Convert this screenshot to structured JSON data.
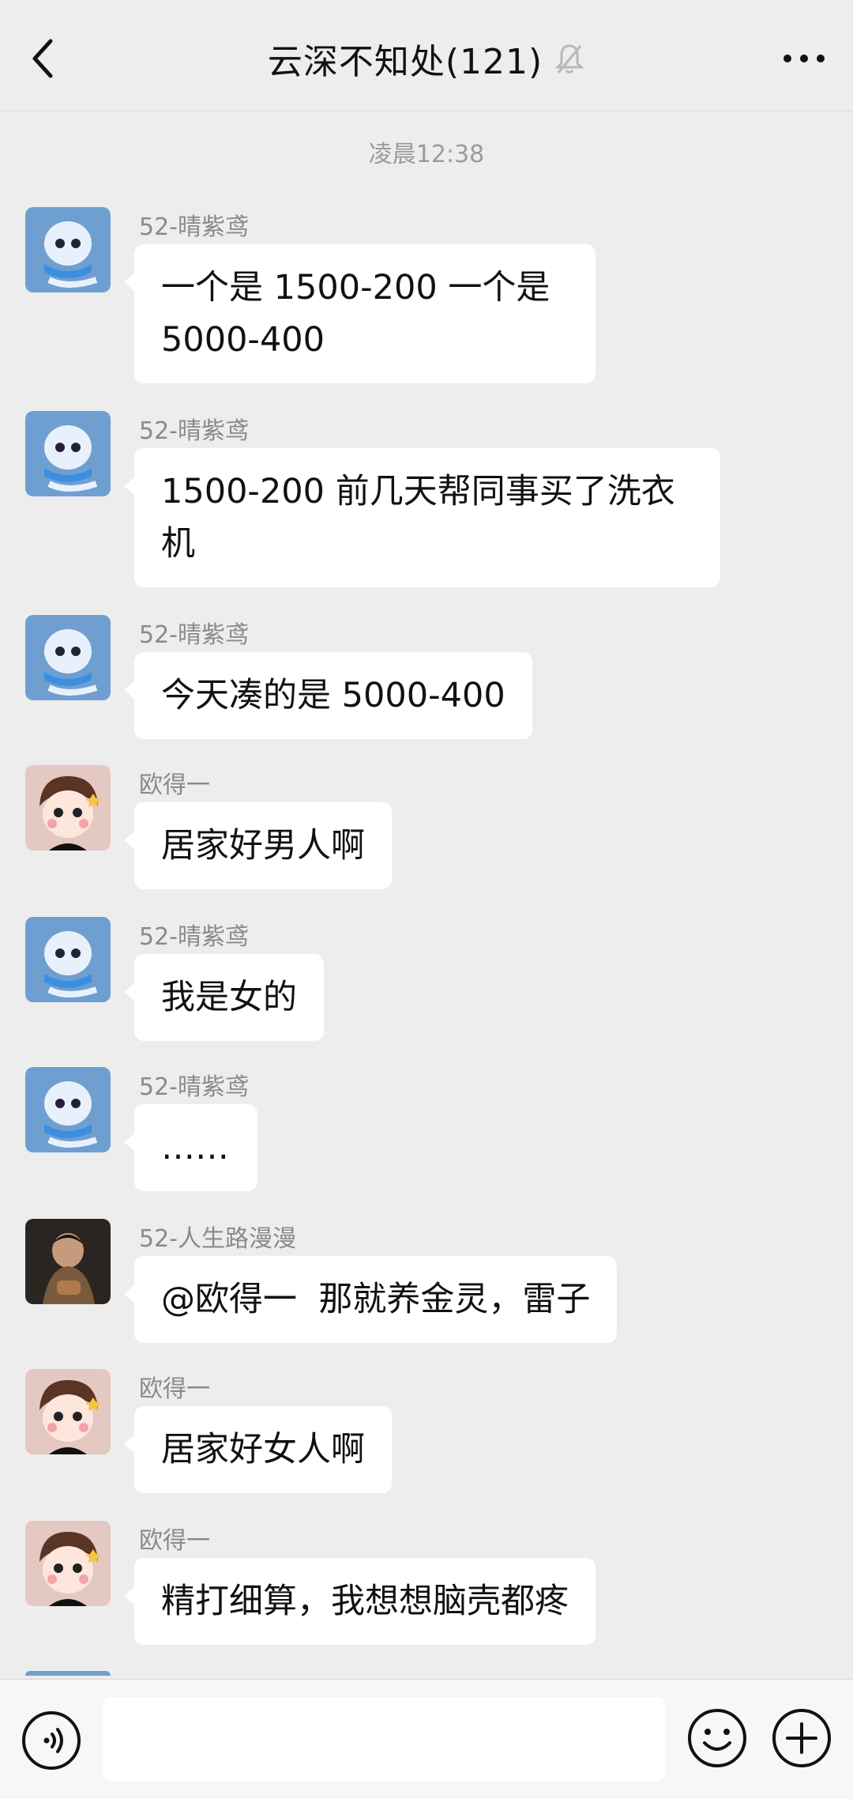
{
  "header": {
    "title": "云深不知处(121)"
  },
  "timestamp": "凌晨12:38",
  "messages": [
    {
      "sender": "52-晴紫鸢",
      "text": "一个是 1500-200 一个是 5000-400",
      "avatar": "blue-snake"
    },
    {
      "sender": "52-晴紫鸢",
      "text": "1500-200 前几天帮同事买了洗衣机",
      "avatar": "blue-snake"
    },
    {
      "sender": "52-晴紫鸢",
      "text": "今天凑的是 5000-400",
      "avatar": "blue-snake"
    },
    {
      "sender": "欧得一",
      "text": "居家好男人啊",
      "avatar": "cartoon-kid"
    },
    {
      "sender": "52-晴紫鸢",
      "text": "我是女的",
      "avatar": "blue-snake"
    },
    {
      "sender": "52-晴紫鸢",
      "text": "……",
      "avatar": "blue-snake"
    },
    {
      "sender": "52-人生路漫漫",
      "text": "@欧得一  那就养金灵，雷子",
      "avatar": "boy-photo"
    },
    {
      "sender": "欧得一",
      "text": "居家好女人啊",
      "avatar": "cartoon-kid"
    },
    {
      "sender": "欧得一",
      "text": "精打细算，我想想脑壳都疼",
      "avatar": "cartoon-kid"
    }
  ],
  "input": {
    "value": ""
  },
  "icons": {
    "back": "back-arrow-icon",
    "mute": "muted-bell-icon",
    "more": "more-dots-icon",
    "voice": "voice-icon",
    "emoji": "emoji-icon",
    "plus": "plus-icon"
  }
}
